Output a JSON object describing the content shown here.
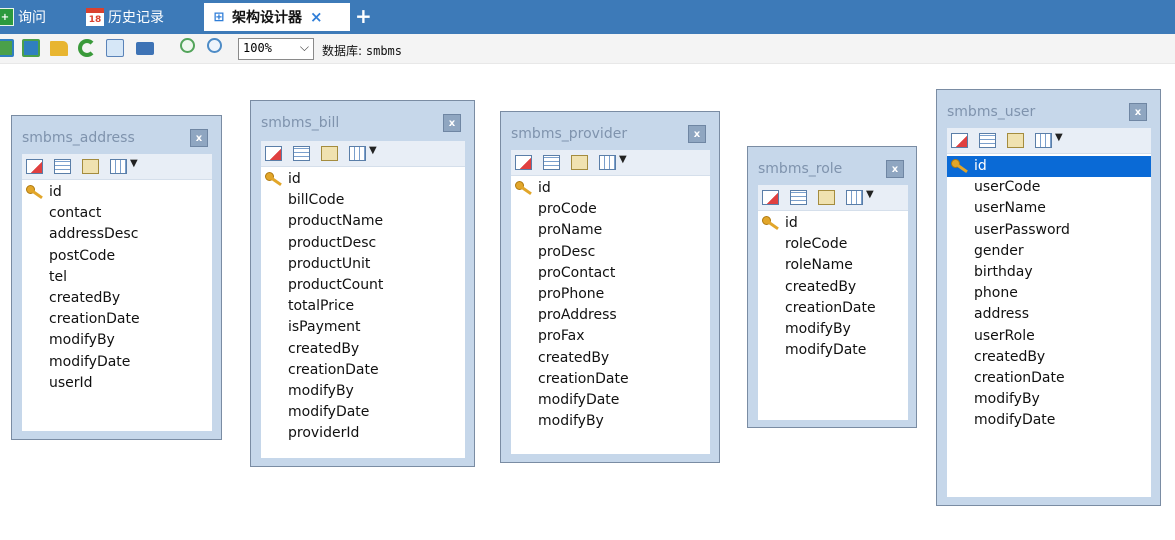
{
  "tabs": [
    {
      "label": "询问",
      "icon": "query-tab-icon"
    },
    {
      "label": "历史记录",
      "icon": "calendar-icon",
      "badge": "18"
    },
    {
      "label": "架构设计器",
      "icon": "schema-designer-icon",
      "active": true
    }
  ],
  "tab_close_glyph": "×",
  "tab_add_glyph": "+",
  "toolbar": {
    "zoom": "100%",
    "database_label": "数据库:",
    "database_name": "smbms"
  },
  "tables": [
    {
      "name": "smbms_address",
      "close": "x",
      "fields": [
        "id",
        "contact",
        "addressDesc",
        "postCode",
        "tel",
        "createdBy",
        "creationDate",
        "modifyBy",
        "modifyDate",
        "userId"
      ]
    },
    {
      "name": "smbms_bill",
      "close": "x",
      "fields": [
        "id",
        "billCode",
        "productName",
        "productDesc",
        "productUnit",
        "productCount",
        "totalPrice",
        "isPayment",
        "createdBy",
        "creationDate",
        "modifyBy",
        "modifyDate",
        "providerId"
      ]
    },
    {
      "name": "smbms_provider",
      "close": "x",
      "fields": [
        "id",
        "proCode",
        "proName",
        "proDesc",
        "proContact",
        "proPhone",
        "proAddress",
        "proFax",
        "createdBy",
        "creationDate",
        "modifyDate",
        "modifyBy"
      ]
    },
    {
      "name": "smbms_role",
      "close": "x",
      "fields": [
        "id",
        "roleCode",
        "roleName",
        "createdBy",
        "creationDate",
        "modifyBy",
        "modifyDate"
      ]
    },
    {
      "name": "smbms_user",
      "close": "x",
      "selected_field": "id",
      "fields": [
        "id",
        "userCode",
        "userName",
        "userPassword",
        "gender",
        "birthday",
        "phone",
        "address",
        "userRole",
        "createdBy",
        "creationDate",
        "modifyBy",
        "modifyDate"
      ]
    }
  ]
}
